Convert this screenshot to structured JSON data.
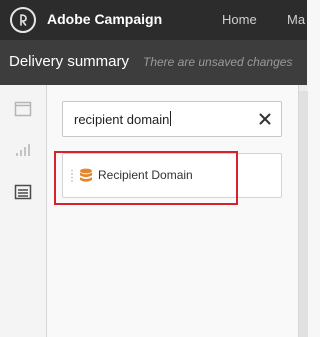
{
  "header": {
    "app_title": "Adobe Campaign",
    "nav": {
      "home": "Home",
      "next": "Ma"
    }
  },
  "titlebar": {
    "title": "Delivery summary",
    "status": "There are unsaved changes"
  },
  "sidebar": {
    "icons": [
      "window-icon",
      "chart-icon",
      "list-icon"
    ]
  },
  "search": {
    "value": "recipient domain"
  },
  "results": [
    {
      "label": "Recipient Domain",
      "icon": "database-icon"
    }
  ],
  "colors": {
    "topbar": "#2c2c2c",
    "titlebar": "#3d3d3d",
    "accent_orange": "#e0872f",
    "highlight_red": "#d8212a"
  }
}
